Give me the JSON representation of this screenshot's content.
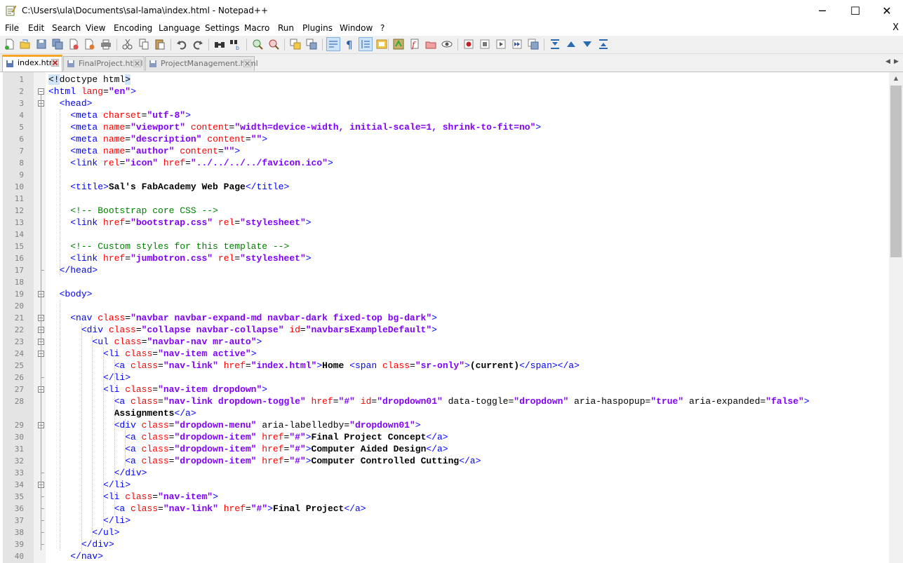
{
  "window": {
    "title": "C:\\Users\\ula\\Documents\\sal-lama\\index.html - Notepad++",
    "minimize": "─",
    "maximize": "☐",
    "close": "✕"
  },
  "menu": {
    "items": [
      "File",
      "Edit",
      "Search",
      "View",
      "Encoding",
      "Language",
      "Settings",
      "Macro",
      "Run",
      "Plugins",
      "Window",
      "?"
    ],
    "close_doc": "X"
  },
  "toolbar": {
    "buttons": [
      "new-file",
      "open-file",
      "save",
      "save-all",
      "close",
      "close-all",
      "print",
      "cut",
      "copy",
      "paste",
      "undo",
      "redo",
      "find",
      "replace",
      "zoom-in",
      "zoom-out",
      "sync-vertical",
      "sync-horizontal",
      "word-wrap",
      "show-all-chars",
      "indent-guide",
      "doc-map",
      "function-list",
      "folder-workspace",
      "doc-list",
      "monitor",
      "record-macro",
      "stop-record",
      "play-macro",
      "run-macro-multiple",
      "save-macro",
      "fold-all",
      "prev-bookmark",
      "next-bookmark",
      "unfold-all"
    ]
  },
  "tabs": [
    {
      "label": "index.html",
      "active": true
    },
    {
      "label": "FinalProject.html",
      "active": false
    },
    {
      "label": "ProjectManagement.html",
      "active": false
    }
  ],
  "tab_scroll": {
    "left": "◀",
    "right": "▶"
  },
  "editor": {
    "lines": [
      {
        "n": "1",
        "tokens": [
          [
            "hl",
            "<!"
          ],
          [
            "",
            "doctype html"
          ],
          [
            "hl",
            ">"
          ]
        ]
      },
      {
        "n": "2",
        "tokens": [
          [
            "t",
            "<html "
          ],
          [
            "a",
            "lang"
          ],
          [
            "",
            "="
          ],
          [
            "v",
            "\"en\""
          ],
          [
            "t",
            ">"
          ]
        ]
      },
      {
        "n": "3",
        "tokens": [
          [
            "",
            "  "
          ],
          [
            "t",
            "<head>"
          ]
        ]
      },
      {
        "n": "4",
        "tokens": [
          [
            "",
            "    "
          ],
          [
            "t",
            "<meta "
          ],
          [
            "a",
            "charset"
          ],
          [
            "",
            "="
          ],
          [
            "v",
            "\"utf-8\""
          ],
          [
            "t",
            ">"
          ]
        ]
      },
      {
        "n": "5",
        "tokens": [
          [
            "",
            "    "
          ],
          [
            "t",
            "<meta "
          ],
          [
            "a",
            "name"
          ],
          [
            "",
            "="
          ],
          [
            "v",
            "\"viewport\""
          ],
          [
            "",
            " "
          ],
          [
            "a",
            "content"
          ],
          [
            "",
            "="
          ],
          [
            "v",
            "\"width=device-width, initial-scale=1, shrink-to-fit=no\""
          ],
          [
            "t",
            ">"
          ]
        ]
      },
      {
        "n": "6",
        "tokens": [
          [
            "",
            "    "
          ],
          [
            "t",
            "<meta "
          ],
          [
            "a",
            "name"
          ],
          [
            "",
            "="
          ],
          [
            "v",
            "\"description\""
          ],
          [
            "",
            " "
          ],
          [
            "a",
            "content"
          ],
          [
            "",
            "="
          ],
          [
            "v",
            "\"\""
          ],
          [
            "t",
            ">"
          ]
        ]
      },
      {
        "n": "7",
        "tokens": [
          [
            "",
            "    "
          ],
          [
            "t",
            "<meta "
          ],
          [
            "a",
            "name"
          ],
          [
            "",
            "="
          ],
          [
            "v",
            "\"author\""
          ],
          [
            "",
            " "
          ],
          [
            "a",
            "content"
          ],
          [
            "",
            "="
          ],
          [
            "v",
            "\"\""
          ],
          [
            "t",
            ">"
          ]
        ]
      },
      {
        "n": "8",
        "tokens": [
          [
            "",
            "    "
          ],
          [
            "t",
            "<link "
          ],
          [
            "a",
            "rel"
          ],
          [
            "",
            "="
          ],
          [
            "v",
            "\"icon\""
          ],
          [
            "",
            " "
          ],
          [
            "a",
            "href"
          ],
          [
            "",
            "="
          ],
          [
            "v",
            "\"../../../../favicon.ico\""
          ],
          [
            "t",
            ">"
          ]
        ]
      },
      {
        "n": "9",
        "tokens": []
      },
      {
        "n": "10",
        "tokens": [
          [
            "",
            "    "
          ],
          [
            "t",
            "<title>"
          ],
          [
            "b",
            "Sal's FabAcademy Web Page"
          ],
          [
            "t",
            "</title>"
          ]
        ]
      },
      {
        "n": "11",
        "tokens": []
      },
      {
        "n": "12",
        "tokens": [
          [
            "",
            "    "
          ],
          [
            "c",
            "<!-- Bootstrap core CSS -->"
          ]
        ]
      },
      {
        "n": "13",
        "tokens": [
          [
            "",
            "    "
          ],
          [
            "t",
            "<link "
          ],
          [
            "a",
            "href"
          ],
          [
            "",
            "="
          ],
          [
            "v",
            "\"bootstrap.css\""
          ],
          [
            "",
            " "
          ],
          [
            "a",
            "rel"
          ],
          [
            "",
            "="
          ],
          [
            "v",
            "\"stylesheet\""
          ],
          [
            "t",
            ">"
          ]
        ]
      },
      {
        "n": "14",
        "tokens": []
      },
      {
        "n": "15",
        "tokens": [
          [
            "",
            "    "
          ],
          [
            "c",
            "<!-- Custom styles for this template -->"
          ]
        ]
      },
      {
        "n": "16",
        "tokens": [
          [
            "",
            "    "
          ],
          [
            "t",
            "<link "
          ],
          [
            "a",
            "href"
          ],
          [
            "",
            "="
          ],
          [
            "v",
            "\"jumbotron.css\""
          ],
          [
            "",
            " "
          ],
          [
            "a",
            "rel"
          ],
          [
            "",
            "="
          ],
          [
            "v",
            "\"stylesheet\""
          ],
          [
            "t",
            ">"
          ]
        ]
      },
      {
        "n": "17",
        "tokens": [
          [
            "",
            "  "
          ],
          [
            "t",
            "</head>"
          ]
        ]
      },
      {
        "n": "18",
        "tokens": []
      },
      {
        "n": "19",
        "tokens": [
          [
            "",
            "  "
          ],
          [
            "t",
            "<body>"
          ]
        ]
      },
      {
        "n": "20",
        "tokens": []
      },
      {
        "n": "21",
        "tokens": [
          [
            "",
            "    "
          ],
          [
            "t",
            "<nav "
          ],
          [
            "a",
            "class"
          ],
          [
            "",
            "="
          ],
          [
            "v",
            "\"navbar navbar-expand-md navbar-dark fixed-top bg-dark\""
          ],
          [
            "t",
            ">"
          ]
        ]
      },
      {
        "n": "22",
        "tokens": [
          [
            "",
            "      "
          ],
          [
            "t",
            "<div "
          ],
          [
            "a",
            "class"
          ],
          [
            "",
            "="
          ],
          [
            "v",
            "\"collapse navbar-collapse\""
          ],
          [
            "",
            " "
          ],
          [
            "a",
            "id"
          ],
          [
            "",
            "="
          ],
          [
            "v",
            "\"navbarsExampleDefault\""
          ],
          [
            "t",
            ">"
          ]
        ]
      },
      {
        "n": "23",
        "tokens": [
          [
            "",
            "        "
          ],
          [
            "t",
            "<ul "
          ],
          [
            "a",
            "class"
          ],
          [
            "",
            "="
          ],
          [
            "v",
            "\"navbar-nav mr-auto\""
          ],
          [
            "t",
            ">"
          ]
        ]
      },
      {
        "n": "24",
        "tokens": [
          [
            "",
            "          "
          ],
          [
            "t",
            "<li "
          ],
          [
            "a",
            "class"
          ],
          [
            "",
            "="
          ],
          [
            "v",
            "\"nav-item active\""
          ],
          [
            "t",
            ">"
          ]
        ]
      },
      {
        "n": "25",
        "tokens": [
          [
            "",
            "            "
          ],
          [
            "t",
            "<a "
          ],
          [
            "a",
            "class"
          ],
          [
            "",
            "="
          ],
          [
            "v",
            "\"nav-link\""
          ],
          [
            "",
            " "
          ],
          [
            "a",
            "href"
          ],
          [
            "",
            "="
          ],
          [
            "v",
            "\"index.html\""
          ],
          [
            "t",
            ">"
          ],
          [
            "b",
            "Home "
          ],
          [
            "t",
            "<span "
          ],
          [
            "a",
            "class"
          ],
          [
            "",
            "="
          ],
          [
            "v",
            "\"sr-only\""
          ],
          [
            "t",
            ">"
          ],
          [
            "b",
            "(current)"
          ],
          [
            "t",
            "</span></a>"
          ]
        ]
      },
      {
        "n": "26",
        "tokens": [
          [
            "",
            "          "
          ],
          [
            "t",
            "</li>"
          ]
        ]
      },
      {
        "n": "27",
        "tokens": [
          [
            "",
            "          "
          ],
          [
            "t",
            "<li "
          ],
          [
            "a",
            "class"
          ],
          [
            "",
            "="
          ],
          [
            "v",
            "\"nav-item dropdown\""
          ],
          [
            "t",
            ">"
          ]
        ]
      },
      {
        "n": "28",
        "tokens": [
          [
            "",
            "            "
          ],
          [
            "t",
            "<a "
          ],
          [
            "a",
            "class"
          ],
          [
            "",
            "="
          ],
          [
            "v",
            "\"nav-link dropdown-toggle\""
          ],
          [
            "",
            " "
          ],
          [
            "a",
            "href"
          ],
          [
            "",
            "="
          ],
          [
            "v",
            "\"#\""
          ],
          [
            "",
            " "
          ],
          [
            "a",
            "id"
          ],
          [
            "",
            "="
          ],
          [
            "v",
            "\"dropdown01\""
          ],
          [
            "",
            " "
          ],
          [
            "",
            "data-toggle"
          ],
          [
            "",
            "="
          ],
          [
            "v",
            "\"dropdown\""
          ],
          [
            "",
            " "
          ],
          [
            "",
            "aria-haspopup"
          ],
          [
            "",
            "="
          ],
          [
            "v",
            "\"true\""
          ],
          [
            "",
            " "
          ],
          [
            "",
            "aria-expanded"
          ],
          [
            "",
            "="
          ],
          [
            "v",
            "\"false\""
          ],
          [
            "t",
            ">"
          ]
        ]
      },
      {
        "n": "",
        "tokens": [
          [
            "",
            "            "
          ],
          [
            "b",
            "Assignments"
          ],
          [
            "t",
            "</a>"
          ]
        ]
      },
      {
        "n": "29",
        "tokens": [
          [
            "",
            "            "
          ],
          [
            "t",
            "<div "
          ],
          [
            "a",
            "class"
          ],
          [
            "",
            "="
          ],
          [
            "v",
            "\"dropdown-menu\""
          ],
          [
            "",
            " "
          ],
          [
            "",
            "aria-labelledby"
          ],
          [
            "",
            "="
          ],
          [
            "v",
            "\"dropdown01\""
          ],
          [
            "t",
            ">"
          ]
        ]
      },
      {
        "n": "30",
        "tokens": [
          [
            "",
            "              "
          ],
          [
            "t",
            "<a "
          ],
          [
            "a",
            "class"
          ],
          [
            "",
            "="
          ],
          [
            "v",
            "\"dropdown-item\""
          ],
          [
            "",
            " "
          ],
          [
            "a",
            "href"
          ],
          [
            "",
            "="
          ],
          [
            "v",
            "\"#\""
          ],
          [
            "t",
            ">"
          ],
          [
            "b",
            "Final Project Concept"
          ],
          [
            "t",
            "</a>"
          ]
        ]
      },
      {
        "n": "31",
        "tokens": [
          [
            "",
            "              "
          ],
          [
            "t",
            "<a "
          ],
          [
            "a",
            "class"
          ],
          [
            "",
            "="
          ],
          [
            "v",
            "\"dropdown-item\""
          ],
          [
            "",
            " "
          ],
          [
            "a",
            "href"
          ],
          [
            "",
            "="
          ],
          [
            "v",
            "\"#\""
          ],
          [
            "t",
            ">"
          ],
          [
            "b",
            "Computer Aided Design"
          ],
          [
            "t",
            "</a>"
          ]
        ]
      },
      {
        "n": "32",
        "tokens": [
          [
            "",
            "              "
          ],
          [
            "t",
            "<a "
          ],
          [
            "a",
            "class"
          ],
          [
            "",
            "="
          ],
          [
            "v",
            "\"dropdown-item\""
          ],
          [
            "",
            " "
          ],
          [
            "a",
            "href"
          ],
          [
            "",
            "="
          ],
          [
            "v",
            "\"#\""
          ],
          [
            "t",
            ">"
          ],
          [
            "b",
            "Computer Controlled Cutting"
          ],
          [
            "t",
            "</a>"
          ]
        ]
      },
      {
        "n": "33",
        "tokens": [
          [
            "",
            "            "
          ],
          [
            "t",
            "</div>"
          ]
        ]
      },
      {
        "n": "34",
        "tokens": [
          [
            "",
            "          "
          ],
          [
            "t",
            "</li>"
          ]
        ]
      },
      {
        "n": "35",
        "tokens": [
          [
            "",
            "          "
          ],
          [
            "t",
            "<li "
          ],
          [
            "a",
            "class"
          ],
          [
            "",
            "="
          ],
          [
            "v",
            "\"nav-item\""
          ],
          [
            "t",
            ">"
          ]
        ]
      },
      {
        "n": "36",
        "tokens": [
          [
            "",
            "            "
          ],
          [
            "t",
            "<a "
          ],
          [
            "a",
            "class"
          ],
          [
            "",
            "="
          ],
          [
            "v",
            "\"nav-link\""
          ],
          [
            "",
            " "
          ],
          [
            "a",
            "href"
          ],
          [
            "",
            "="
          ],
          [
            "v",
            "\"#\""
          ],
          [
            "t",
            ">"
          ],
          [
            "b",
            "Final Project"
          ],
          [
            "t",
            "</a>"
          ]
        ]
      },
      {
        "n": "37",
        "tokens": [
          [
            "",
            "          "
          ],
          [
            "t",
            "</li>"
          ]
        ]
      },
      {
        "n": "38",
        "tokens": [
          [
            "",
            "        "
          ],
          [
            "t",
            "</ul>"
          ]
        ]
      },
      {
        "n": "39",
        "tokens": [
          [
            "",
            "      "
          ],
          [
            "t",
            "</div>"
          ]
        ]
      },
      {
        "n": "40",
        "tokens": [
          [
            "",
            "    "
          ],
          [
            "t",
            "</nav>"
          ]
        ]
      }
    ]
  },
  "colors": {
    "tag": "#0000ff",
    "attribute": "#ff0000",
    "value": "#8000ff",
    "comment": "#008000",
    "active_tab_accent": "#f5a524"
  }
}
